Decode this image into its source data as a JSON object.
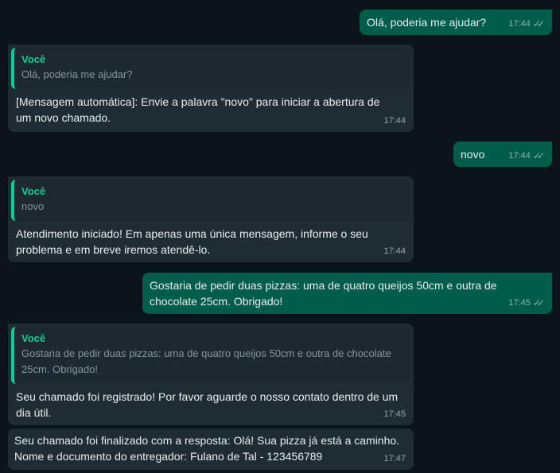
{
  "messages": [
    {
      "dir": "out",
      "text": "Olá, poderia me ajudar?",
      "time": "17:44"
    },
    {
      "dir": "in",
      "quote": {
        "author": "Você",
        "text": "Olá, poderia me ajudar?"
      },
      "text": "[Mensagem automática]: Envie a palavra \"novo\" para iniciar a abertura de um novo chamado.",
      "time": "17:44"
    },
    {
      "dir": "out",
      "text": "novo",
      "time": "17:44"
    },
    {
      "dir": "in",
      "quote": {
        "author": "Você",
        "text": "novo"
      },
      "text": "Atendimento iniciado! Em apenas uma única mensagem, informe o seu problema e em breve iremos atendê-lo.",
      "time": "17:44"
    },
    {
      "dir": "out",
      "text": "Gostaria de pedir duas pizzas: uma de quatro queijos 50cm e outra de chocolate 25cm. Obrigado!",
      "time": "17:45"
    },
    {
      "dir": "in",
      "quote": {
        "author": "Você",
        "text": "Gostaria de pedir duas pizzas: uma de quatro queijos 50cm e outra de chocolate 25cm. Obrigado!"
      },
      "text": "Seu chamado foi registrado! Por favor aguarde o nosso contato dentro de um dia útil.",
      "time": "17:45"
    },
    {
      "dir": "in",
      "text": "Seu chamado foi finalizado com a resposta: Olá! Sua pizza já está a caminho. Nome e documento do entregador: Fulano de Tal - 123456789",
      "time": "17:47"
    }
  ],
  "colors": {
    "outgoing": "#005c4b",
    "incoming": "#202c33",
    "quote_accent": "#06cf9c",
    "background": "#0b141a"
  },
  "icons": {
    "read_receipt": "double-check-icon"
  }
}
